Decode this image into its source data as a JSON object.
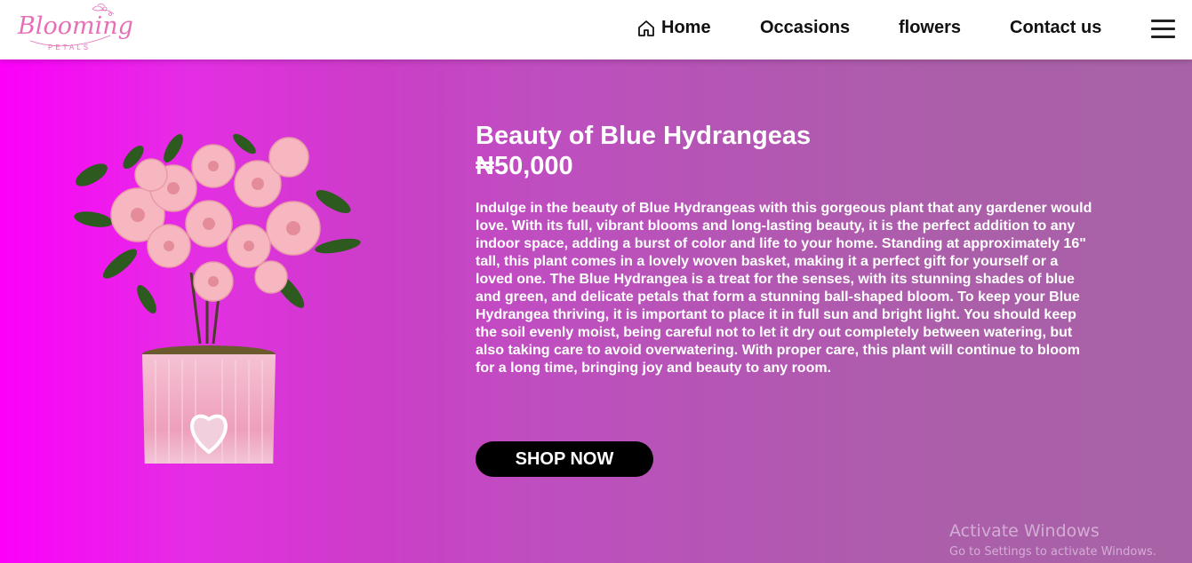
{
  "header": {
    "logo": {
      "word": "Blooming",
      "sub": "PETALS"
    },
    "nav": [
      {
        "label": "Home",
        "icon": "home-icon"
      },
      {
        "label": "Occasions"
      },
      {
        "label": "flowers"
      },
      {
        "label": "Contact us"
      }
    ],
    "menu_icon": "hamburger-icon"
  },
  "product": {
    "title": "Beauty of Blue Hydrangeas",
    "price": "₦50,000",
    "description": "Indulge in the beauty of Blue Hydrangeas with this gorgeous plant that any gardener would love. With its full, vibrant blooms and long-lasting beauty, it is the perfect addition to any indoor space, adding a burst of color and life to your home. Standing at approximately 16\" tall, this plant comes in a lovely woven basket, making it a perfect gift for yourself or a loved one. The Blue Hydrangea is a treat for the senses, with its stunning shades of blue and green, and delicate petals that form a stunning ball-shaped bloom. To keep your Blue Hydrangea thriving, it is important to place it in full sun and bright light. You should keep the soil evenly moist, being careful not to let it dry out completely between watering, but also taking care to avoid overwatering. With proper care, this plant will continue to bloom for a long time, bringing joy and beauty to any room.",
    "cta": "SHOP NOW"
  },
  "watermark": {
    "title": "Activate Windows",
    "subtitle": "Go to Settings to activate Windows."
  },
  "colors": {
    "gradient_start": "#fc00fa",
    "gradient_end": "#a862a6",
    "logo": "#e66fb7",
    "button": "#000000"
  }
}
